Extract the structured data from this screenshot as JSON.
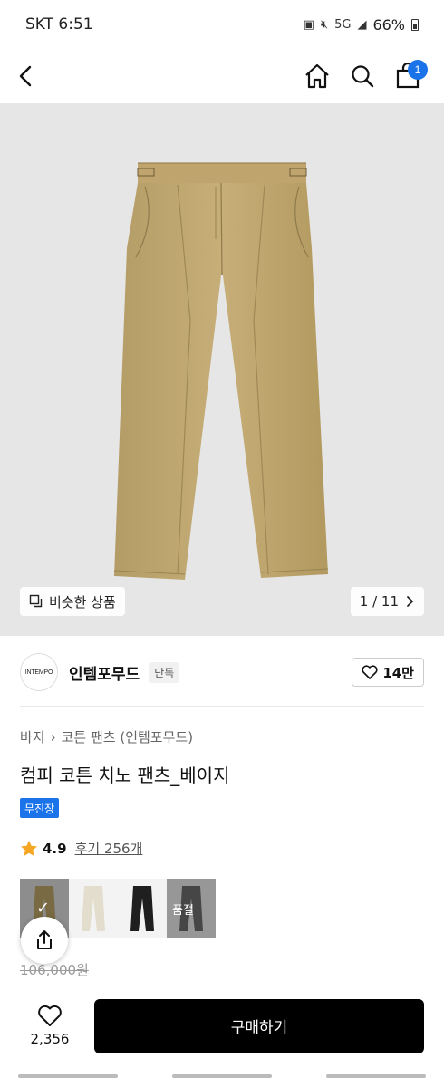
{
  "status_bar": {
    "carrier_time": "SKT 6:51",
    "network": "5G",
    "battery": "66%"
  },
  "nav": {
    "cart_count": "1"
  },
  "hero": {
    "similar_label": "비슷한 상품",
    "pager": "1 / 11"
  },
  "brand": {
    "logo_text": "INTEMPO",
    "name": "인템포무드",
    "tag": "단독",
    "likes": "14만"
  },
  "product": {
    "breadcrumb": [
      "바지",
      "코튼 팬츠 (인템포무드)"
    ],
    "title": "컴피 코튼 치노 팬츠_베이지",
    "shipping_badge": "무진장",
    "rating": "4.9",
    "reviews": "후기 256개",
    "soldout_label": "품절",
    "original_price": "106,000원"
  },
  "colors": [
    {
      "name": "beige",
      "hex": "#b9a06a"
    },
    {
      "name": "ivory",
      "hex": "#e7e2d4"
    },
    {
      "name": "black",
      "hex": "#1f1f1f"
    },
    {
      "name": "charcoal",
      "hex": "#2a2a2a"
    }
  ],
  "bottom": {
    "wish_count": "2,356",
    "buy_label": "구매하기"
  }
}
